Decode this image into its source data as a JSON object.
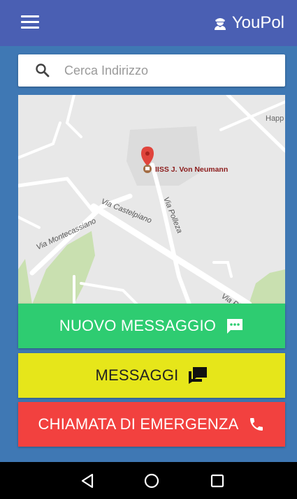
{
  "appbar": {
    "brand": "YouPol",
    "menu_icon": "hamburger-menu-icon",
    "brand_icon": "police-officer-icon"
  },
  "search": {
    "placeholder": "Cerca Indirizzo",
    "value": "",
    "icon": "search-icon"
  },
  "map": {
    "marker_label": "IISS J. Von Neumann",
    "streets": [
      "Via Castelpiano",
      "Via Montecassiano",
      "Via Polleza"
    ],
    "edge_label": "Happ",
    "street_edge_label": "Via P",
    "colors": {
      "background": "#e8e8e8",
      "road": "#ffffff",
      "park": "#c9e0b0",
      "marker": "#e0443c"
    }
  },
  "buttons": {
    "new_message": {
      "label": "NUOVO MESSAGGIO",
      "icon": "chat-message-icon",
      "color": "#2ecc71"
    },
    "messages": {
      "label": "MESSAGGI",
      "icon": "messages-forum-icon",
      "color": "#e6e61a"
    },
    "emergency_call": {
      "label": "CHIAMATA DI EMERGENZA",
      "icon": "phone-icon",
      "color": "#f2413f"
    }
  },
  "navbar": {
    "back_icon": "back-triangle-icon",
    "home_icon": "home-circle-icon",
    "recents_icon": "recents-square-icon"
  }
}
